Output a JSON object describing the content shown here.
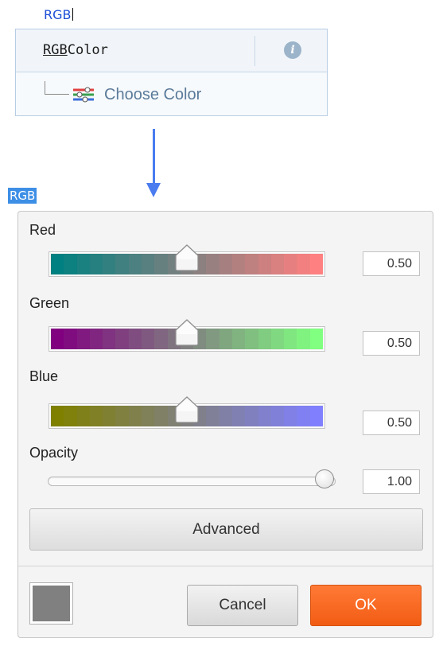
{
  "editor": {
    "typed_text": "RGB",
    "autocomplete": {
      "item_name_match": "RGB",
      "item_name_rest": "Color",
      "info_icon": "info-icon",
      "sub_item_icon": "color-sliders-icon",
      "sub_item_label": "Choose Color"
    },
    "highlight_text": "RGB",
    "arrow_color": "#4a7cf0"
  },
  "color_dialog": {
    "channels": [
      {
        "label": "Red",
        "value": "0.50",
        "fraction": 0.5,
        "from_color": "#008080",
        "to_color": "#ff8080"
      },
      {
        "label": "Green",
        "value": "0.50",
        "fraction": 0.5,
        "from_color": "#800080",
        "to_color": "#80ff80"
      },
      {
        "label": "Blue",
        "value": "0.50",
        "fraction": 0.5,
        "from_color": "#808000",
        "to_color": "#8080ff"
      }
    ],
    "opacity": {
      "label": "Opacity",
      "value": "1.00",
      "fraction": 1.0
    },
    "advanced_label": "Advanced",
    "preview_color": "#808080",
    "cancel_label": "Cancel",
    "ok_label": "OK",
    "ok_color": "#f4631a"
  }
}
